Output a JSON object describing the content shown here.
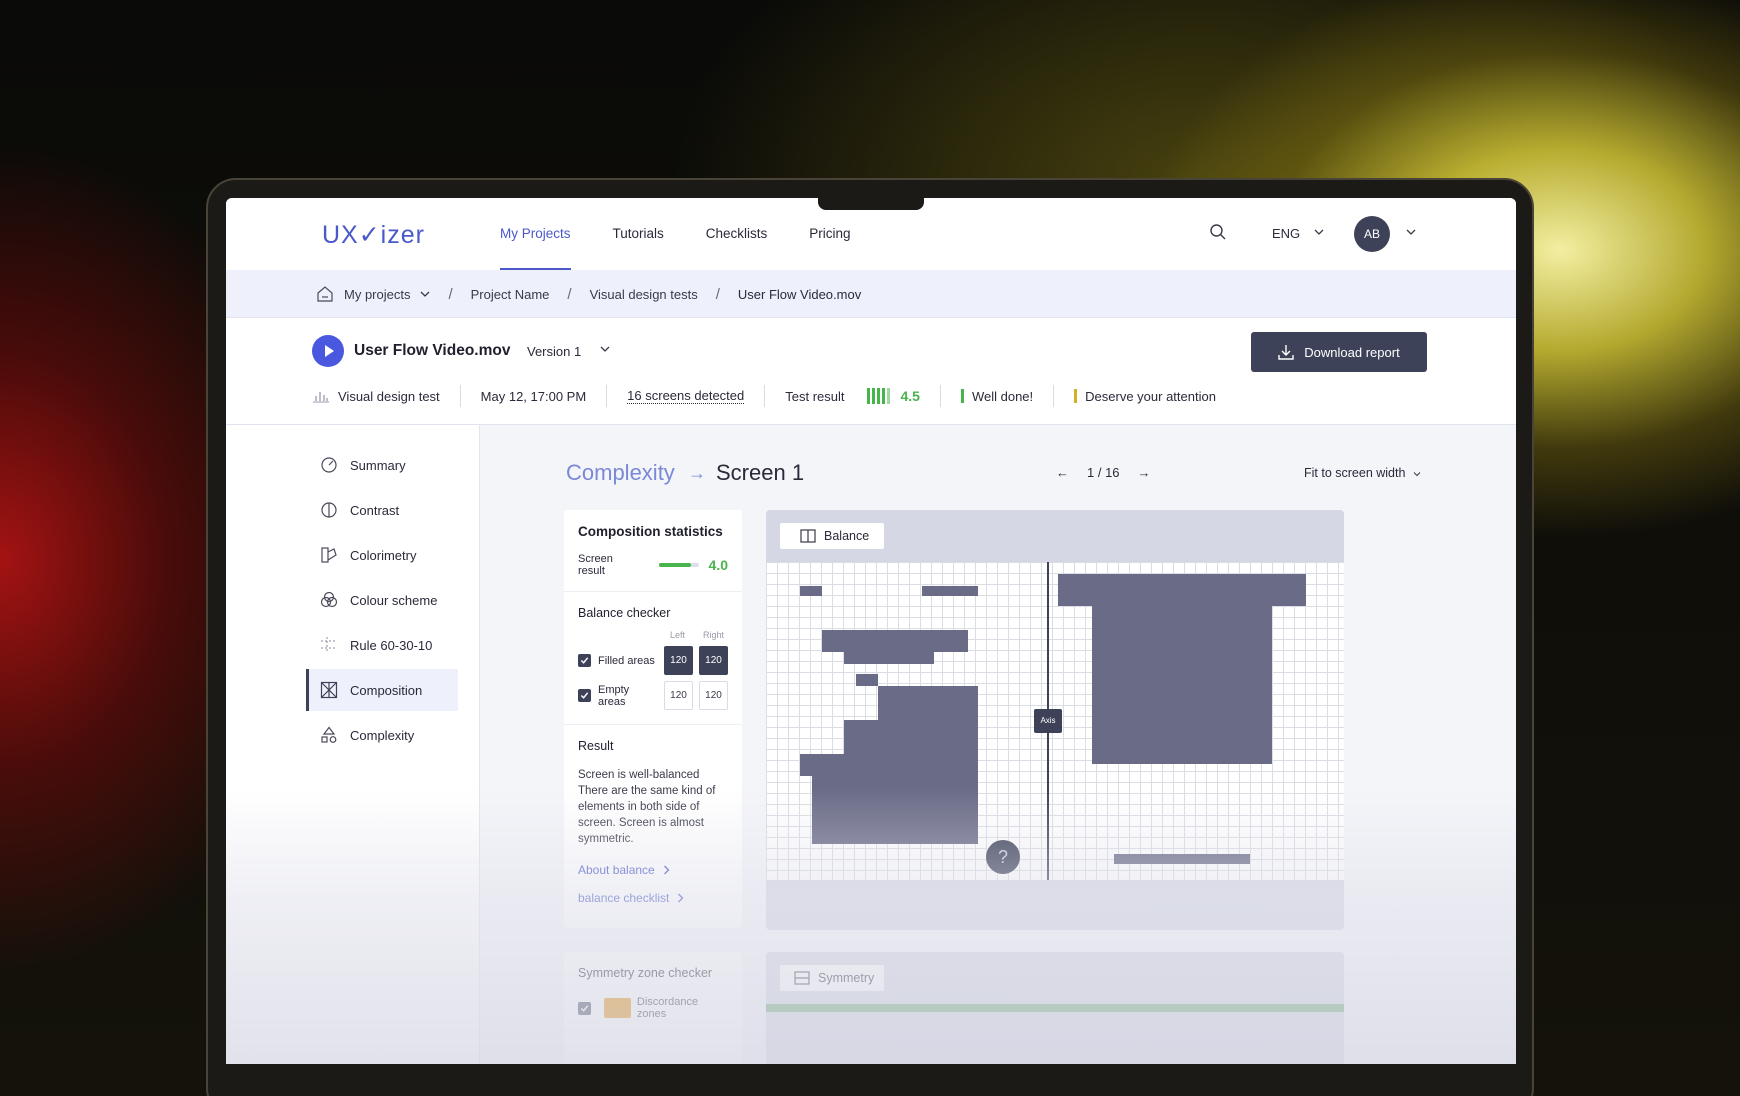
{
  "app": {
    "logo": "UX✓izer",
    "nav": [
      "My Projects",
      "Tutorials",
      "Checklists",
      "Pricing"
    ],
    "language": "ENG",
    "avatar_initials": "AB"
  },
  "breadcrumb": [
    "My projects",
    "Project Name",
    "Visual design tests",
    "User Flow Video.mov"
  ],
  "file": {
    "title": "User Flow Video.mov",
    "version": "Version 1",
    "download_label": "Download report",
    "meta": {
      "test_type": "Visual design test",
      "date": "May 12, 17:00 PM",
      "screens": "16 screens detected",
      "result_label": "Test result",
      "result_score": "4.5",
      "well_done": "Well done!",
      "attention": "Deserve your attention"
    }
  },
  "sidebar": {
    "items": [
      "Summary",
      "Contrast",
      "Colorimetry",
      "Colour scheme",
      "Rule 60-30-10",
      "Composition",
      "Complexity"
    ],
    "active": "Composition"
  },
  "main": {
    "section": "Complexity",
    "screen": "Screen 1",
    "pager": "1 / 16",
    "fit": "Fit to screen width"
  },
  "composition": {
    "title": "Composition statistics",
    "screen_result_label": "Screen result",
    "screen_result": "4.0",
    "screen_result_level": 0.8,
    "balance_checker": "Balance checker",
    "left": "Left",
    "right": "Right",
    "filled_label": "Filled  areas",
    "filled_left": "120",
    "filled_right": "120",
    "empty_label": "Empty areas",
    "empty_left": "120",
    "empty_right": "120",
    "result_title": "Result",
    "result_text": "Screen is well-balanced There are the same kind of elements in both side of screen. Screen is almost symmetric.",
    "about_link": "About balance",
    "checklist_link": "balance  checklist"
  },
  "canvas": {
    "tab": "Balance",
    "axis": "Axis",
    "help": "?"
  },
  "symmetry": {
    "title": "Symmetry zone checker",
    "discordance": "Discordance zones",
    "tab": "Symmetry"
  }
}
